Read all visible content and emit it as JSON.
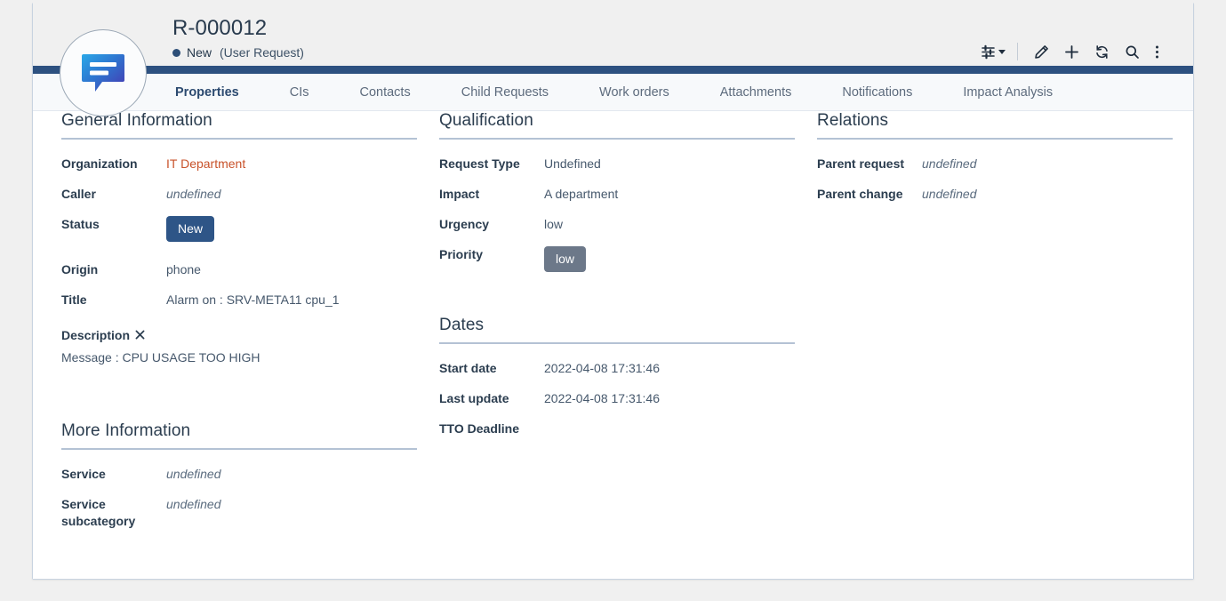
{
  "record": {
    "title": "R-000012",
    "status_label": "New",
    "type_label": "(User Request)",
    "avatar_icon": "speech-bubble-icon",
    "status_dot_color": "#2d4e77"
  },
  "toolbar": {
    "items": [
      {
        "icon": "sliders-filter-icon",
        "has_caret": true
      },
      {
        "icon": "separator"
      },
      {
        "icon": "pencil-edit-icon"
      },
      {
        "icon": "plus-add-icon"
      },
      {
        "icon": "refresh-icon"
      },
      {
        "icon": "search-icon"
      },
      {
        "icon": "more-vertical-icon"
      }
    ]
  },
  "tabs": [
    {
      "label": "Properties",
      "active": true
    },
    {
      "label": "CIs",
      "active": false
    },
    {
      "label": "Contacts",
      "active": false
    },
    {
      "label": "Child Requests",
      "active": false
    },
    {
      "label": "Work orders",
      "active": false
    },
    {
      "label": "Attachments",
      "active": false
    },
    {
      "label": "Notifications",
      "active": false
    },
    {
      "label": "Impact Analysis",
      "active": false
    }
  ],
  "sections": {
    "general_information": {
      "title": "General Information",
      "organization_label": "Organization",
      "organization_value": "IT Department",
      "caller_label": "Caller",
      "caller_value": "undefined",
      "status_label": "Status",
      "status_value": "New",
      "origin_label": "Origin",
      "origin_value": "phone",
      "title_label": "Title",
      "title_value": "Alarm on : SRV-META11 cpu_1",
      "description_label": "Description",
      "description_value": "Message : CPU USAGE TOO HIGH"
    },
    "more_information": {
      "title": "More Information",
      "service_label": "Service",
      "service_value": "undefined",
      "service_subcategory_label": "Service subcategory",
      "service_subcategory_value": "undefined"
    },
    "qualification": {
      "title": "Qualification",
      "request_type_label": "Request Type",
      "request_type_value": "Undefined",
      "impact_label": "Impact",
      "impact_value": "A department",
      "urgency_label": "Urgency",
      "urgency_value": "low",
      "priority_label": "Priority",
      "priority_value": "low"
    },
    "dates": {
      "title": "Dates",
      "start_date_label": "Start date",
      "start_date_value": "2022-04-08 17:31:46",
      "last_update_label": "Last update",
      "last_update_value": "2022-04-08 17:31:46",
      "tto_deadline_label": "TTO Deadline",
      "tto_deadline_value": ""
    },
    "relations": {
      "title": "Relations",
      "parent_request_label": "Parent request",
      "parent_request_value": "undefined",
      "parent_change_label": "Parent change",
      "parent_change_value": "undefined"
    }
  },
  "colors": {
    "navy_bar": "#2d5180",
    "accent_link": "#c8522a",
    "badge_new": "#2e5587",
    "badge_low": "#6c7889",
    "rule": "#b4c2d4",
    "page_background": "#f0f0f0"
  }
}
